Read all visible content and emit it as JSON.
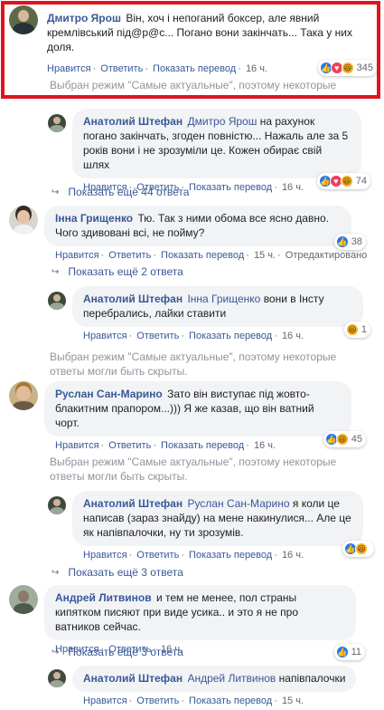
{
  "labels": {
    "like": "Нравится",
    "reply": "Ответить",
    "translate": "Показать перевод",
    "edited": "Отредактировано",
    "filter_notice": "Выбран режим \"Самые актуальные\", поэтому некоторые ответы могли быть скрыты."
  },
  "comments": [
    {
      "author": "Дмитро Ярош",
      "text": "Він, хоч і непоганий боксер, але явний кремлівський під@р@с... Погано вони закінчать... Така у них доля.",
      "time": "16 ч.",
      "reaction_count": "345",
      "reactions": [
        "like-icon",
        "love-icon",
        "haha-icon"
      ]
    },
    {
      "author": "Анатолий Штефан",
      "mention": "Дмитро Ярош",
      "text": "на рахунок погано закінчать, згоден повністю... Нажаль але за 5 років вони і не зрозуміли це. Кожен обирає свій шлях",
      "time": "16 ч.",
      "reaction_count": "74",
      "reactions": [
        "like-icon",
        "love-icon",
        "haha-icon"
      ]
    },
    {
      "author": "Інна Грищенко",
      "text": "Тю. Так з ними обома все ясно давно. Чого здивовані всі, не пойму?",
      "time": "15 ч.",
      "reaction_count": "38",
      "reactions": [
        "like-icon"
      ]
    },
    {
      "author": "Анатолий Штефан",
      "mention": "Інна Грищенко",
      "text": "вони в Інсту перебрались, лайки ставити",
      "time": "16 ч.",
      "reaction_count": "1",
      "reactions": [
        "haha-icon"
      ]
    },
    {
      "author": "Руслан Сан-Марино",
      "text": "Зато він виступає під жовто-блакитним прапором...))) Я же казав, що він ватний чорт.",
      "time": "16 ч.",
      "reaction_count": "45",
      "reactions": [
        "like-icon",
        "haha-icon"
      ]
    },
    {
      "author": "Анатолий Штефан",
      "mention": "Руслан Сан-Марино",
      "text": "я коли це написав (зараз знайду) на мене накинулися... Але це як напівпалочки, ну ти зрозумів.",
      "time": "16 ч.",
      "reaction_count": "",
      "reactions": [
        "like-icon",
        "haha-icon"
      ]
    },
    {
      "author": "Андрей Литвинов",
      "text": "и тем не менее, пол страны кипятком писяют при виде усика.. и это я не про ватников сейчас.",
      "time": "16 ч.",
      "reaction_count": "11",
      "reactions": [
        "like-icon"
      ]
    },
    {
      "author": "Анатолий Штефан",
      "mention": "Андрей Литвинов",
      "text": "напівпалочки",
      "time": "15 ч.",
      "reaction_count": "",
      "reactions": []
    }
  ],
  "more_replies": [
    "Показать ещё 44 ответа",
    "Показать ещё 2 ответа",
    "Показать ещё 3 ответа",
    "Показать ещё 3 ответа"
  ],
  "colors": {
    "highlight": "#e0141e",
    "link": "#385898",
    "bubble": "#f2f3f5"
  }
}
